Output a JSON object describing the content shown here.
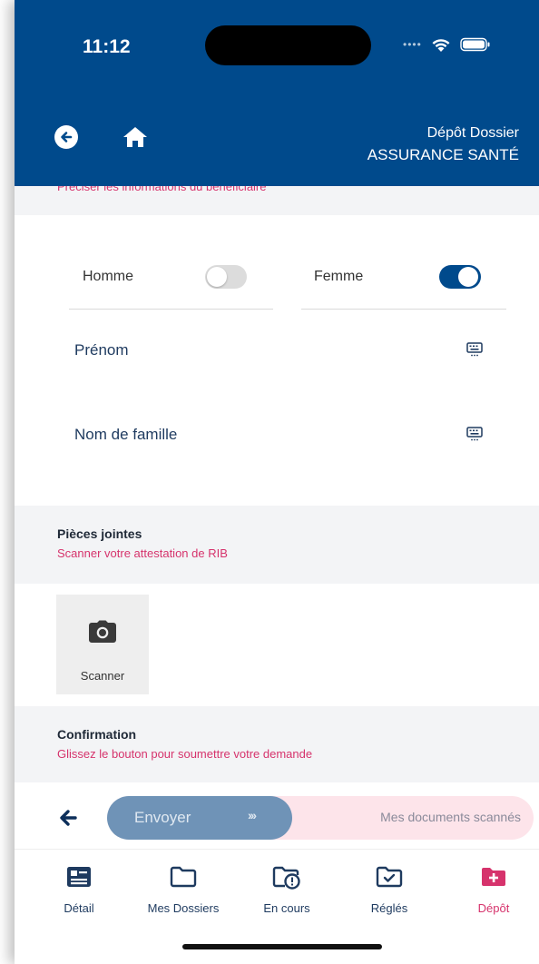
{
  "status_bar": {
    "time": "11:12"
  },
  "header": {
    "title_line1": "Dépôt Dossier",
    "title_line2": "ASSURANCE SANTÉ"
  },
  "beneficiary": {
    "hint": "Préciser les informations du bénéficiaire",
    "gender": [
      {
        "label": "Homme",
        "selected": false
      },
      {
        "label": "Femme",
        "selected": true
      }
    ],
    "fields": [
      {
        "label": "Prénom",
        "value": ""
      },
      {
        "label": "Nom de famille",
        "value": ""
      }
    ]
  },
  "attachments": {
    "title": "Pièces jointes",
    "subtitle": "Scanner votre attestation de RIB",
    "scan_label": "Scanner"
  },
  "confirmation": {
    "title": "Confirmation",
    "subtitle": "Glissez le bouton pour soumettre votre demande"
  },
  "slider": {
    "button_label": "Envoyer",
    "button_chevrons": "›››",
    "track_label": "Mes documents scannés"
  },
  "tabs": [
    {
      "label": "Détail",
      "icon": "id-card-icon"
    },
    {
      "label": "Mes Dossiers",
      "icon": "folder-icon"
    },
    {
      "label": "En cours",
      "icon": "folder-alert-icon"
    },
    {
      "label": "Réglés",
      "icon": "folder-check-icon"
    },
    {
      "label": "Dépôt",
      "icon": "folder-plus-icon",
      "active": true
    }
  ],
  "colors": {
    "primary": "#004a8c",
    "accent": "#d6336c",
    "slider_button": "#6f93b7",
    "slider_track": "#fde4ea"
  }
}
